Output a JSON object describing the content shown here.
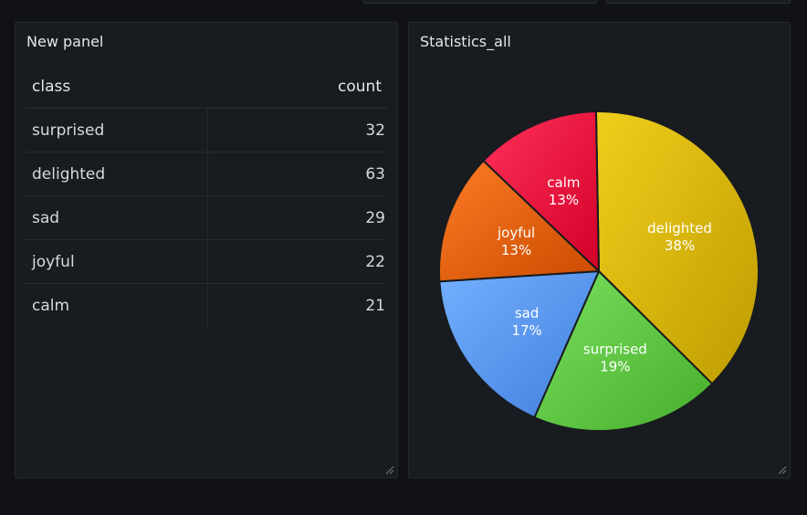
{
  "table_panel": {
    "title": "New panel",
    "columns": {
      "class": "class",
      "count": "count"
    },
    "rows": [
      {
        "class": "surprised",
        "count": "32"
      },
      {
        "class": "delighted",
        "count": "63"
      },
      {
        "class": "sad",
        "count": "29"
      },
      {
        "class": "joyful",
        "count": "22"
      },
      {
        "class": "calm",
        "count": "21"
      }
    ]
  },
  "pie_panel": {
    "title": "Statistics_all"
  },
  "chart_data": {
    "type": "pie",
    "title": "Statistics_all",
    "slices": [
      {
        "label": "delighted",
        "value": 63,
        "percent": "38%",
        "color": "#d4b200"
      },
      {
        "label": "surprised",
        "value": 32,
        "percent": "19%",
        "color": "#5dc442"
      },
      {
        "label": "sad",
        "value": 29,
        "percent": "17%",
        "color": "#5794f2"
      },
      {
        "label": "joyful",
        "value": 22,
        "percent": "13%",
        "color": "#e0600a"
      },
      {
        "label": "calm",
        "value": 21,
        "percent": "13%",
        "color": "#e8153e"
      }
    ]
  }
}
